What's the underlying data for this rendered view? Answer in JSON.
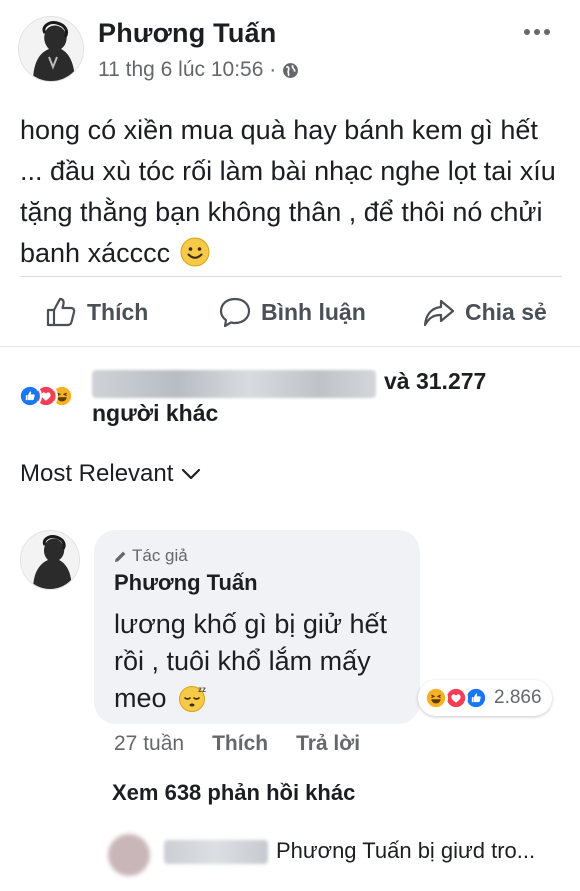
{
  "post": {
    "author": "Phương Tuấn",
    "timestamp": "11 thg 6 lúc 10:56 ·",
    "privacy_icon": "globe-icon",
    "text": "hong có xiền mua quà hay bánh kem gì hết ... đầu xù tóc rối làm bài nhạc nghe lọt tai xíu tặng thằng bạn không thân , để thôi nó chửi banh xácccc",
    "trailing_emoji": "smile-emoji"
  },
  "actions": {
    "like_label": "Thích",
    "comment_label": "Bình luận",
    "share_label": "Chia sẻ"
  },
  "reactions": {
    "types": [
      "like",
      "love",
      "haha"
    ],
    "count_text": "và 31.277",
    "others_text": "người khác"
  },
  "sort": {
    "label": "Most Relevant"
  },
  "comment": {
    "author_badge": "Tác giả",
    "author": "Phương Tuấn",
    "text": "lương khố gì bị giử hết rồi , tuôi khổ lắm mấy meo",
    "trailing_emoji": "sleepy-emoji",
    "reaction_types": [
      "haha",
      "love",
      "like"
    ],
    "reaction_count": "2.866",
    "age": "27 tuần",
    "like_label": "Thích",
    "reply_label": "Trả lời"
  },
  "more_replies": {
    "label": "Xem 638 phản hồi khác"
  },
  "reply_preview": {
    "text": "Phương Tuấn bị giưd tro..."
  },
  "colors": {
    "text": "#1c1e21",
    "secondary_text": "#65676b",
    "like_blue": "#1877f2",
    "love_red": "#f33e58",
    "haha_yellow": "#f7b125",
    "bubble_bg": "#f0f2f5"
  }
}
